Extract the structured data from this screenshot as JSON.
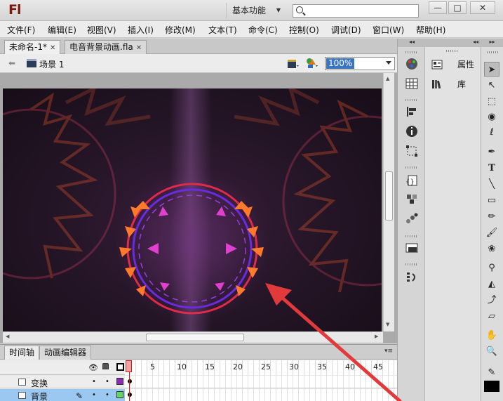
{
  "app": {
    "logo": "Fl",
    "workspace": "基本功能",
    "search_placeholder": ""
  },
  "menu": [
    "文件(F)",
    "编辑(E)",
    "视图(V)",
    "插入(I)",
    "修改(M)",
    "文本(T)",
    "命令(C)",
    "控制(O)",
    "调试(D)",
    "窗口(W)",
    "帮助(H)"
  ],
  "doc_tabs": [
    {
      "label": "未命名-1*",
      "active": true
    },
    {
      "label": "电音背景动画.fla",
      "active": false
    }
  ],
  "scene": {
    "label": "场景 1"
  },
  "zoom": {
    "value": "100%"
  },
  "timeline": {
    "tabs": [
      "时间轴",
      "动画编辑器"
    ],
    "ruler_numbers": [
      "1",
      "5",
      "10",
      "15",
      "20",
      "25",
      "30",
      "35",
      "40",
      "45"
    ],
    "layers": [
      {
        "name": "变换",
        "selected": false,
        "color": "#8c2ab5"
      },
      {
        "name": "背景",
        "selected": true,
        "color": "#5fd85f"
      }
    ]
  },
  "panels": {
    "properties_label": "属性",
    "library_label": "库"
  },
  "colors": {
    "accent": "#3a75c4",
    "layer_selected": "#9bc8f0",
    "arrow": "#e23a3a"
  }
}
